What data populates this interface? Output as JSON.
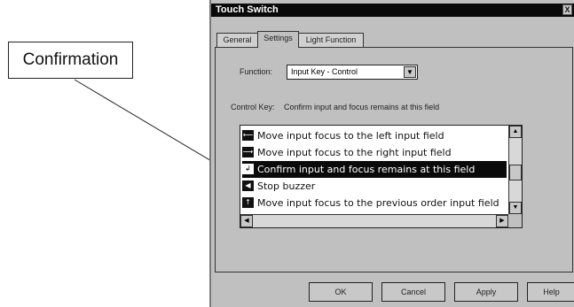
{
  "callout": {
    "label": "Confirmation"
  },
  "window": {
    "title": "Touch Switch",
    "close_glyph": "X"
  },
  "tabs": [
    {
      "label": "General"
    },
    {
      "label": "Settings"
    },
    {
      "label": "Light Function"
    }
  ],
  "settings": {
    "function_label": "Function:",
    "function_value": "Input Key - Control",
    "control_key_label": "Control Key:",
    "control_key_value": "Confirm  input and focus remains at this field"
  },
  "list": {
    "items": [
      {
        "icon": "arrow-left-icon",
        "glyph": "⟵",
        "text": "Move input focus to the left input field",
        "selected": false
      },
      {
        "icon": "arrow-right-icon",
        "glyph": "⟶",
        "text": "Move input focus to the right input field",
        "selected": false
      },
      {
        "icon": "enter-icon",
        "glyph": "↲",
        "text": "Confirm  input and focus remains at this field",
        "selected": true
      },
      {
        "icon": "speaker-icon",
        "glyph": "◀",
        "text": "Stop buzzer",
        "selected": false
      },
      {
        "icon": "arrow-up-icon",
        "glyph": "↑",
        "text": "Move input focus to the previous order input field",
        "selected": false
      }
    ]
  },
  "buttons": {
    "ok": "OK",
    "cancel": "Cancel",
    "apply": "Apply",
    "help": "Help"
  }
}
